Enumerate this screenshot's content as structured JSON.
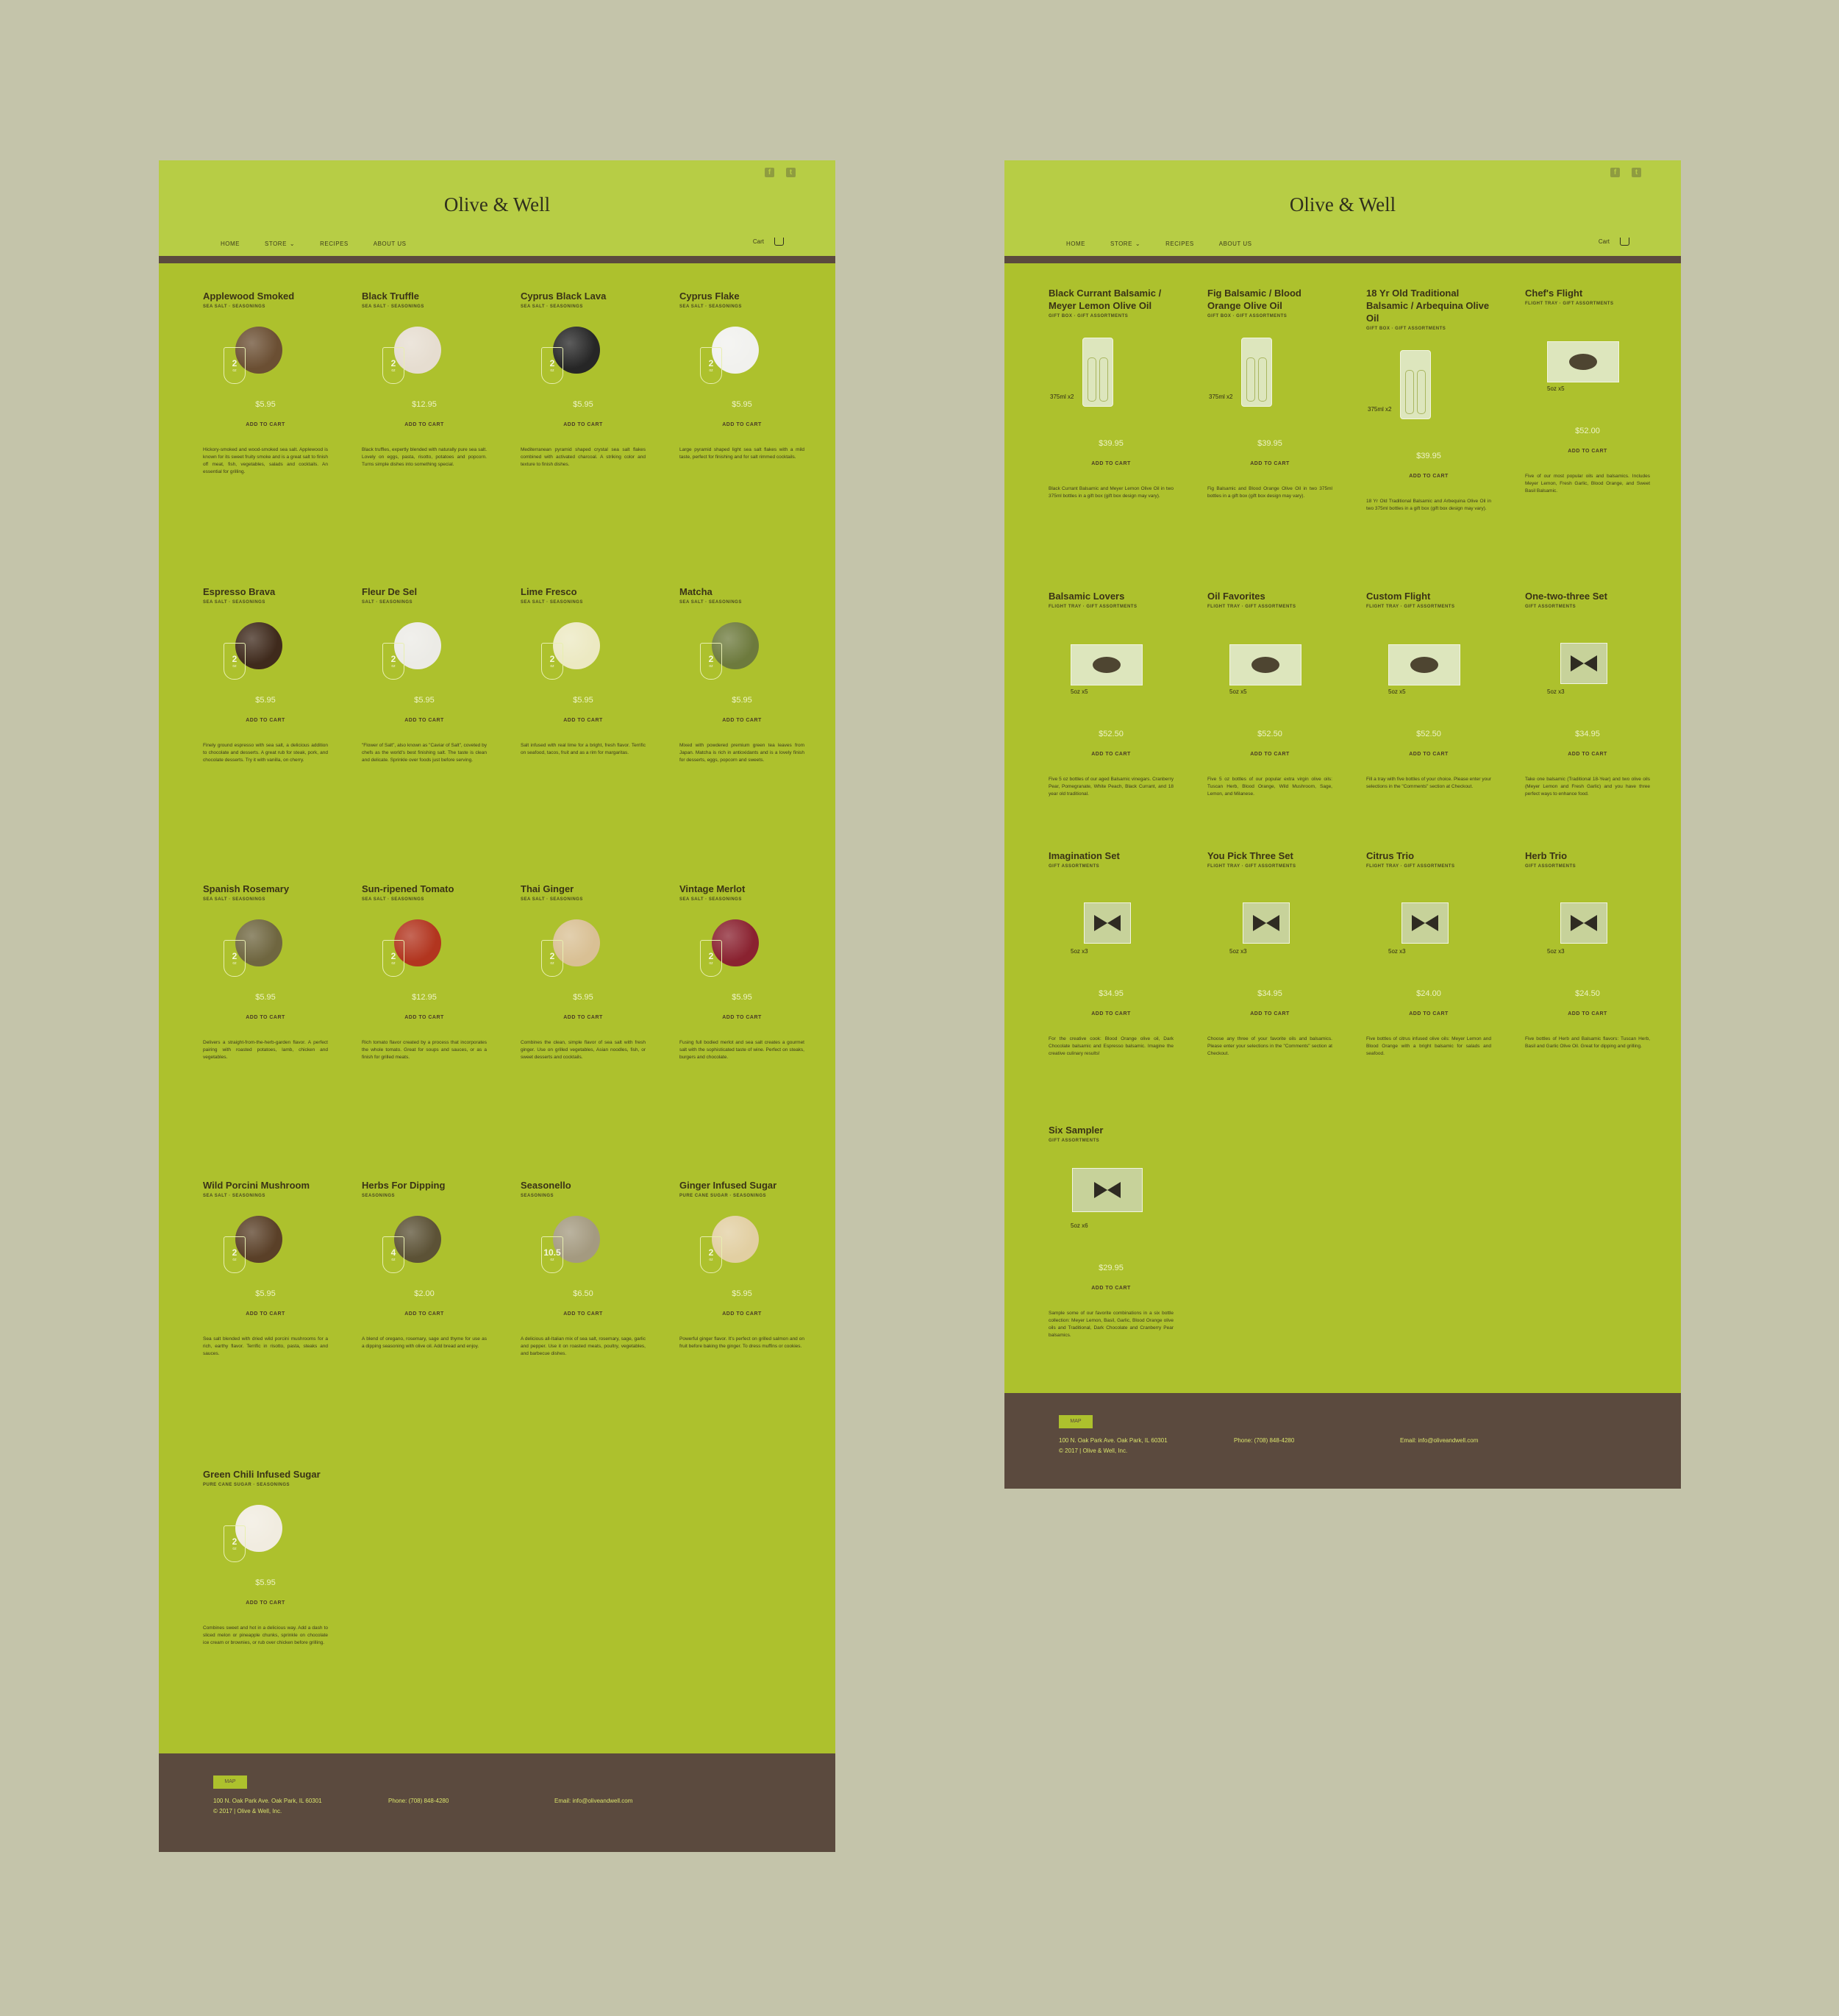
{
  "logo": "Olive & Well",
  "nav": [
    "HOME",
    "STORE",
    "RECIPES",
    "ABOUT US"
  ],
  "store_chevron": "⌄",
  "cart_label": "Cart",
  "social": [
    {
      "name": "facebook-icon",
      "glyph": "f"
    },
    {
      "name": "twitter-icon",
      "glyph": "t"
    }
  ],
  "add_to_cart": "ADD TO CART",
  "salts": [
    {
      "name": "Applewood Smoked",
      "cat": "SEA SALT · SEASONINGS",
      "price": "$5.95",
      "qty": "2",
      "unit": "oz",
      "color": "#6b4f33",
      "desc": "Hickory-smoked and wood-smoked sea salt. Applewood is known for its sweet fruity smoke and is a great salt to finish off meat, fish, vegetables, salads and cocktails. An essential for grilling."
    },
    {
      "name": "Black Truffle",
      "cat": "SEA SALT · SEASONINGS",
      "price": "$12.95",
      "qty": "2",
      "unit": "oz",
      "color": "#e6ddd0",
      "desc": "Black truffles, expertly blended with naturally pure sea salt. Lovely on eggs, pasta, risotto, potatoes and popcorn. Turns simple dishes into something special."
    },
    {
      "name": "Cyprus Black Lava",
      "cat": "SEA SALT · SEASONINGS",
      "price": "$5.95",
      "qty": "2",
      "unit": "oz",
      "color": "#262626",
      "desc": "Mediterranean pyramid shaped crystal sea salt flakes combined with activated charcoal. A striking color and texture to finish dishes."
    },
    {
      "name": "Cyprus Flake",
      "cat": "SEA SALT · SEASONINGS",
      "price": "$5.95",
      "qty": "2",
      "unit": "oz",
      "color": "#f1f1ee",
      "desc": "Large pyramid shaped light sea salt flakes with a mild taste, perfect for finishing and for salt rimmed cocktails."
    },
    {
      "name": "Espresso Brava",
      "cat": "SEA SALT · SEASONINGS",
      "price": "$5.95",
      "qty": "2",
      "unit": "oz",
      "color": "#3f2a1c",
      "desc": "Finely ground espresso with sea salt, a delicious addition to chocolate and desserts. A great rub for steak, pork, and chocolate desserts. Try it with vanilla, on cherry."
    },
    {
      "name": "Fleur De Sel",
      "cat": "SALT · SEASONINGS",
      "price": "$5.95",
      "qty": "2",
      "unit": "oz",
      "color": "#ecebe6",
      "desc": "\"Flower of Salt\", also known as \"Caviar of Salt\", coveted by chefs as the world's best finishing salt. The taste is clean and delicate. Sprinkle over foods just before serving."
    },
    {
      "name": "Lime Fresco",
      "cat": "SEA SALT · SEASONINGS",
      "price": "$5.95",
      "qty": "2",
      "unit": "oz",
      "color": "#ece9c2",
      "desc": "Salt infused with real lime for a bright, fresh flavor. Terrific on seafood, tacos, fruit and as a rim for margaritas."
    },
    {
      "name": "Matcha",
      "cat": "SEA SALT · SEASONINGS",
      "price": "$5.95",
      "qty": "2",
      "unit": "oz",
      "color": "#6d7a3d",
      "desc": "Mixed with powdered premium green tea leaves from Japan. Matcha is rich in antioxidants and is a lovely finish for desserts, eggs, popcorn and sweets."
    },
    {
      "name": "Spanish Rosemary",
      "cat": "SEA SALT · SEASONINGS",
      "price": "$5.95",
      "qty": "2",
      "unit": "oz",
      "color": "#6f6640",
      "desc": "Delivers a straight-from-the-herb-garden flavor. A perfect pairing with roasted potatoes, lamb, chicken and vegetables."
    },
    {
      "name": "Sun-ripened Tomato",
      "cat": "SEA SALT · SEASONINGS",
      "price": "$12.95",
      "qty": "2",
      "unit": "oz",
      "color": "#b2351f",
      "desc": "Rich tomato flavor created by a process that incorporates the whole tomato. Great for soups and sauces, or as a finish for grilled meats."
    },
    {
      "name": "Thai Ginger",
      "cat": "SEA SALT · SEASONINGS",
      "price": "$5.95",
      "qty": "2",
      "unit": "oz",
      "color": "#d9c094",
      "desc": "Combines the clean, simple flavor of sea salt with fresh ginger. Use on grilled vegetables, Asian noodles, fish, or sweet desserts and cocktails."
    },
    {
      "name": "Vintage Merlot",
      "cat": "SEA SALT · SEASONINGS",
      "price": "$5.95",
      "qty": "2",
      "unit": "oz",
      "color": "#8a2230",
      "desc": "Fusing full bodied merlot and sea salt creates a gourmet salt with the sophisticated taste of wine. Perfect on steaks, burgers and chocolate."
    },
    {
      "name": "Wild Porcini Mushroom",
      "cat": "SEA SALT · SEASONINGS",
      "price": "$5.95",
      "qty": "2",
      "unit": "oz",
      "color": "#5a4028",
      "desc": "Sea salt blended with dried wild porcini mushrooms for a rich, earthy flavor. Terrific in risotto, pasta, steaks and sauces."
    },
    {
      "name": "Herbs For Dipping",
      "cat": "SEASONINGS",
      "price": "$2.00",
      "qty": "4",
      "unit": "oz",
      "color": "#5c5236",
      "desc": "A blend of oregano, rosemary, sage and thyme for use as a dipping seasoning with olive oil. Add bread and enjoy."
    },
    {
      "name": "Seasonello",
      "cat": "SEASONINGS",
      "price": "$6.50",
      "qty": "10.5",
      "unit": "oz",
      "color": "#a49a80",
      "desc": "A delicious all-Italian mix of sea salt, rosemary, sage, garlic and pepper. Use it on roasted meats, poultry, vegetables, and barbecue dishes."
    },
    {
      "name": "Ginger Infused Sugar",
      "cat": "PURE CANE SUGAR · SEASONINGS",
      "price": "$5.95",
      "qty": "2",
      "unit": "oz",
      "color": "#e2cfa2",
      "desc": "Powerful ginger flavor. It's perfect on grilled salmon and on fruit before baking the ginger. To dress muffins or cookies."
    },
    {
      "name": "Green Chili Infused Sugar",
      "cat": "PURE CANE SUGAR · SEASONINGS",
      "price": "$5.95",
      "qty": "2",
      "unit": "oz",
      "color": "#f1ece0",
      "desc": "Combines sweet and hot in a delicious way. Add a dash to sliced melon or pineapple chunks, sprinkle on chocolate ice cream or brownies, or rub over chicken before grilling."
    }
  ],
  "gifts": [
    {
      "name": "Black Currant Balsamic / Meyer Lemon Olive Oil",
      "cat": "GIFT BOX · GIFT ASSORTMENTS",
      "price": "$39.95",
      "qty": "375ml x2",
      "box": "vertical",
      "desc": "Black Currant Balsamic and Meyer Lemon Olive Oil in two 375ml bottles in a gift box (gift box design may vary)."
    },
    {
      "name": "Fig Balsamic / Blood Orange Olive Oil",
      "cat": "GIFT BOX · GIFT ASSORTMENTS",
      "price": "$39.95",
      "qty": "375ml x2",
      "box": "vertical",
      "desc": "Fig Balsamic and Blood Orange Olive Oil in two 375ml bottles in a gift box (gift box design may vary)."
    },
    {
      "name": "18 Yr Old Traditional Balsamic / Arbequina Olive Oil",
      "cat": "GIFT BOX · GIFT ASSORTMENTS",
      "price": "$39.95",
      "qty": "375ml x2",
      "box": "vertical",
      "desc": "18 Yr Old Traditional Balsamic and Arbequina Olive Oil in two 375ml bottles in a gift box (gift box design may vary)."
    },
    {
      "name": "Chef's Flight",
      "cat": "FLIGHT TRAY · GIFT ASSORTMENTS",
      "price": "$52.00",
      "qty": "5oz x5",
      "box": "tray",
      "desc": "Five of our most popular oils and balsamics. Includes Meyer Lemon, Fresh Garlic, Blood Orange, and Sweet Basil Balsamic."
    },
    {
      "name": "Balsamic Lovers",
      "cat": "FLIGHT TRAY · GIFT ASSORTMENTS",
      "price": "$52.50",
      "qty": "5oz x5",
      "box": "tray",
      "desc": "Five 5 oz bottles of our aged Balsamic vinegars. Cranberry Pear, Pomegranate, White Peach, Black Currant, and 18 year old traditional."
    },
    {
      "name": "Oil Favorites",
      "cat": "FLIGHT TRAY · GIFT ASSORTMENTS",
      "price": "$52.50",
      "qty": "5oz x5",
      "box": "tray",
      "desc": "Five 5 oz bottles of our popular extra virgin olive oils: Tuscan Herb, Blood Orange, Wild Mushroom, Sage, Lemon, and Milanese."
    },
    {
      "name": "Custom Flight",
      "cat": "FLIGHT TRAY · GIFT ASSORTMENTS",
      "price": "$52.50",
      "qty": "5oz x5",
      "box": "tray",
      "desc": "Fill a tray with five bottles of your choice. Please enter your selections in the \"Comments\" section at Checkout."
    },
    {
      "name": "One-two-three Set",
      "cat": "GIFT ASSORTMENTS",
      "price": "$34.95",
      "qty": "5oz x3",
      "box": "set",
      "desc": "Take one balsamic (Traditional 18-Year) and two olive oils (Meyer Lemon and Fresh Garlic) and you have three perfect ways to enhance food."
    },
    {
      "name": "Imagination Set",
      "cat": "GIFT ASSORTMENTS",
      "price": "$34.95",
      "qty": "5oz x3",
      "box": "set",
      "desc": "For the creative cook: Blood Orange olive oil, Dark Chocolate balsamic and Espresso balsamic. Imagine the creative culinary results!"
    },
    {
      "name": "You Pick Three Set",
      "cat": "FLIGHT TRAY · GIFT ASSORTMENTS",
      "price": "$34.95",
      "qty": "5oz x3",
      "box": "set",
      "desc": "Choose any three of your favorite oils and balsamics. Please enter your selections in the \"Comments\" section at Checkout."
    },
    {
      "name": "Citrus Trio",
      "cat": "FLIGHT TRAY · GIFT ASSORTMENTS",
      "price": "$24.00",
      "qty": "5oz x3",
      "box": "set",
      "desc": "Five bottles of citrus infused olive oils: Meyer Lemon and Blood Orange with a bright balsamic for salads and seafood."
    },
    {
      "name": "Herb Trio",
      "cat": "GIFT ASSORTMENTS",
      "price": "$24.50",
      "qty": "5oz x3",
      "box": "set",
      "desc": "Five bottles of Herb and Balsamic flavors: Tuscan Herb, Basil and Garlic Olive Oil. Great for dipping and grilling."
    },
    {
      "name": "Six Sampler",
      "cat": "GIFT ASSORTMENTS",
      "price": "$29.95",
      "qty": "5oz x6",
      "box": "six",
      "desc": "Sample some of our favorite combinations in a six bottle collection: Meyer Lemon, Basil, Garlic, Blood Orange olive oils and Traditional, Dark Chocolate and Cranberry Pear balsamics."
    }
  ],
  "footer": {
    "map": "MAP",
    "address": "100 N. Oak Park Ave. Oak Park, IL 60301",
    "copyright": "© 2017 | Olive & Well, Inc.",
    "phone": "Phone: (708) 848-4280",
    "email": "Email: info@oliveandwell.com"
  }
}
